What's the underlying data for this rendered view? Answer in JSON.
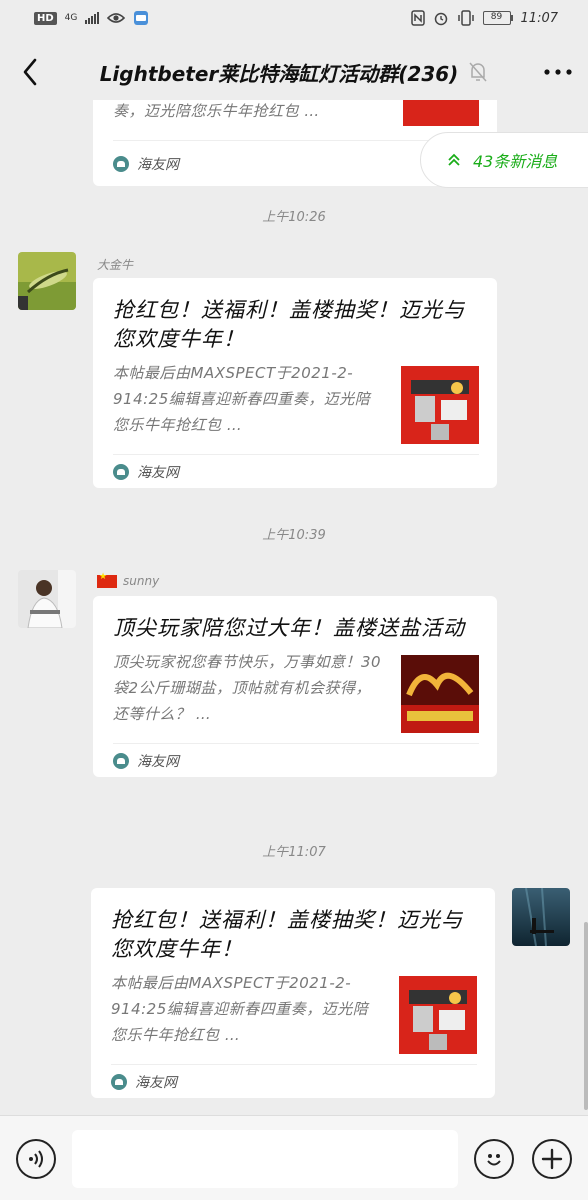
{
  "status_bar": {
    "hd": "HD",
    "network": "4G",
    "battery": "89",
    "time": "11:07"
  },
  "header": {
    "title": "Lightbeter莱比特海缸灯活动群(236)",
    "icons": [
      "back-arrow-icon",
      "mute-bell-icon",
      "more-dots-icon"
    ]
  },
  "new_messages": {
    "label": "43条新消息",
    "icon": "double-chevron-up-icon",
    "color": "#1aad19"
  },
  "messages": [
    {
      "type": "partial-card",
      "desc": "奏，迈光陪您乐牛年抢红包 …",
      "source": "海友网"
    },
    {
      "time": "上午10:26",
      "sender": "大金牛",
      "title": "抢红包！送福利！盖楼抽奖！迈光与您欢度牛年！",
      "desc": "本帖最后由MAXSPECT于2021-2-914:25编辑喜迎新春四重奏，迈光陪您乐牛年抢红包 …",
      "source": "海友网"
    },
    {
      "time": "上午10:39",
      "sender": "sunny",
      "title": "顶尖玩家陪您过大年！盖楼送盐活动",
      "desc": "顶尖玩家祝您春节快乐，万事如意！30袋2公斤珊瑚盐，顶帖就有机会获得，还等什么？ …",
      "source": "海友网"
    },
    {
      "time": "上午11:07",
      "sender": "",
      "title": "抢红包！送福利！盖楼抽奖！迈光与您欢度牛年！",
      "desc": "本帖最后由MAXSPECT于2021-2-914:25编辑喜迎新春四重奏，迈光陪您乐牛年抢红包 …",
      "source": "海友网"
    }
  ],
  "input_bar": {
    "placeholder": "",
    "icons": [
      "voice-icon",
      "emoji-icon",
      "plus-icon"
    ]
  }
}
